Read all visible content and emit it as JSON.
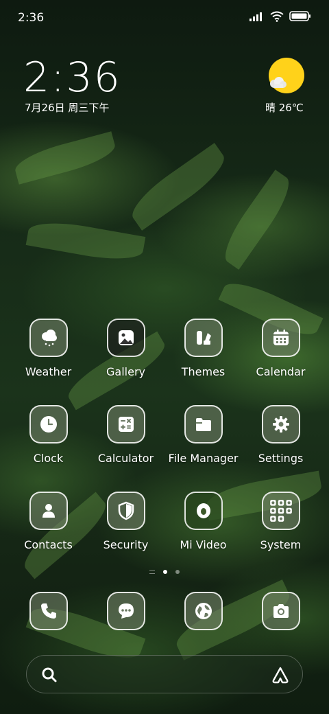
{
  "status_bar": {
    "time": "2:36",
    "icons": [
      "signal-icon",
      "wifi-icon",
      "battery-icon"
    ]
  },
  "clock_widget": {
    "time": "2:36",
    "date": "7月26日 周三下午"
  },
  "weather_widget": {
    "condition_temp": "晴 26℃",
    "icon": "sun-cloud-icon"
  },
  "apps": [
    {
      "label": "Weather",
      "icon": "weather-icon"
    },
    {
      "label": "Gallery",
      "icon": "gallery-icon"
    },
    {
      "label": "Themes",
      "icon": "themes-icon"
    },
    {
      "label": "Calendar",
      "icon": "calendar-icon"
    },
    {
      "label": "Clock",
      "icon": "clock-icon"
    },
    {
      "label": "Calculator",
      "icon": "calculator-icon"
    },
    {
      "label": "File Manager",
      "icon": "folder-icon"
    },
    {
      "label": "Settings",
      "icon": "gear-icon"
    },
    {
      "label": "Contacts",
      "icon": "person-icon"
    },
    {
      "label": "Security",
      "icon": "shield-icon"
    },
    {
      "label": "Mi Video",
      "icon": "video-icon"
    },
    {
      "label": "System",
      "icon": "folder-grid-icon"
    }
  ],
  "dock": [
    {
      "icon": "phone-icon"
    },
    {
      "icon": "message-icon"
    },
    {
      "icon": "browser-icon"
    },
    {
      "icon": "camera-icon"
    }
  ],
  "page_indicator": {
    "pages": 2,
    "active": 1
  },
  "search_bar": {
    "left_icon": "search-icon",
    "right_icon": "assistant-icon"
  },
  "colors": {
    "sun": "#ffd21a",
    "tile_border": "#ffffff"
  }
}
